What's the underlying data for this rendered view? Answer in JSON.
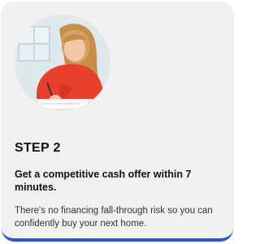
{
  "card": {
    "step_label": "STEP 2",
    "headline": "Get a competitive cash offer within 7 minutes.",
    "body": "There's no financing fall-through risk so you can confidently buy your next home.",
    "photo_alt": "Woman in red sweater writing at a desk"
  },
  "colors": {
    "card_background": "#f1f1f1",
    "accent_border": "#2f55c9",
    "sweater": "#e8402f"
  }
}
